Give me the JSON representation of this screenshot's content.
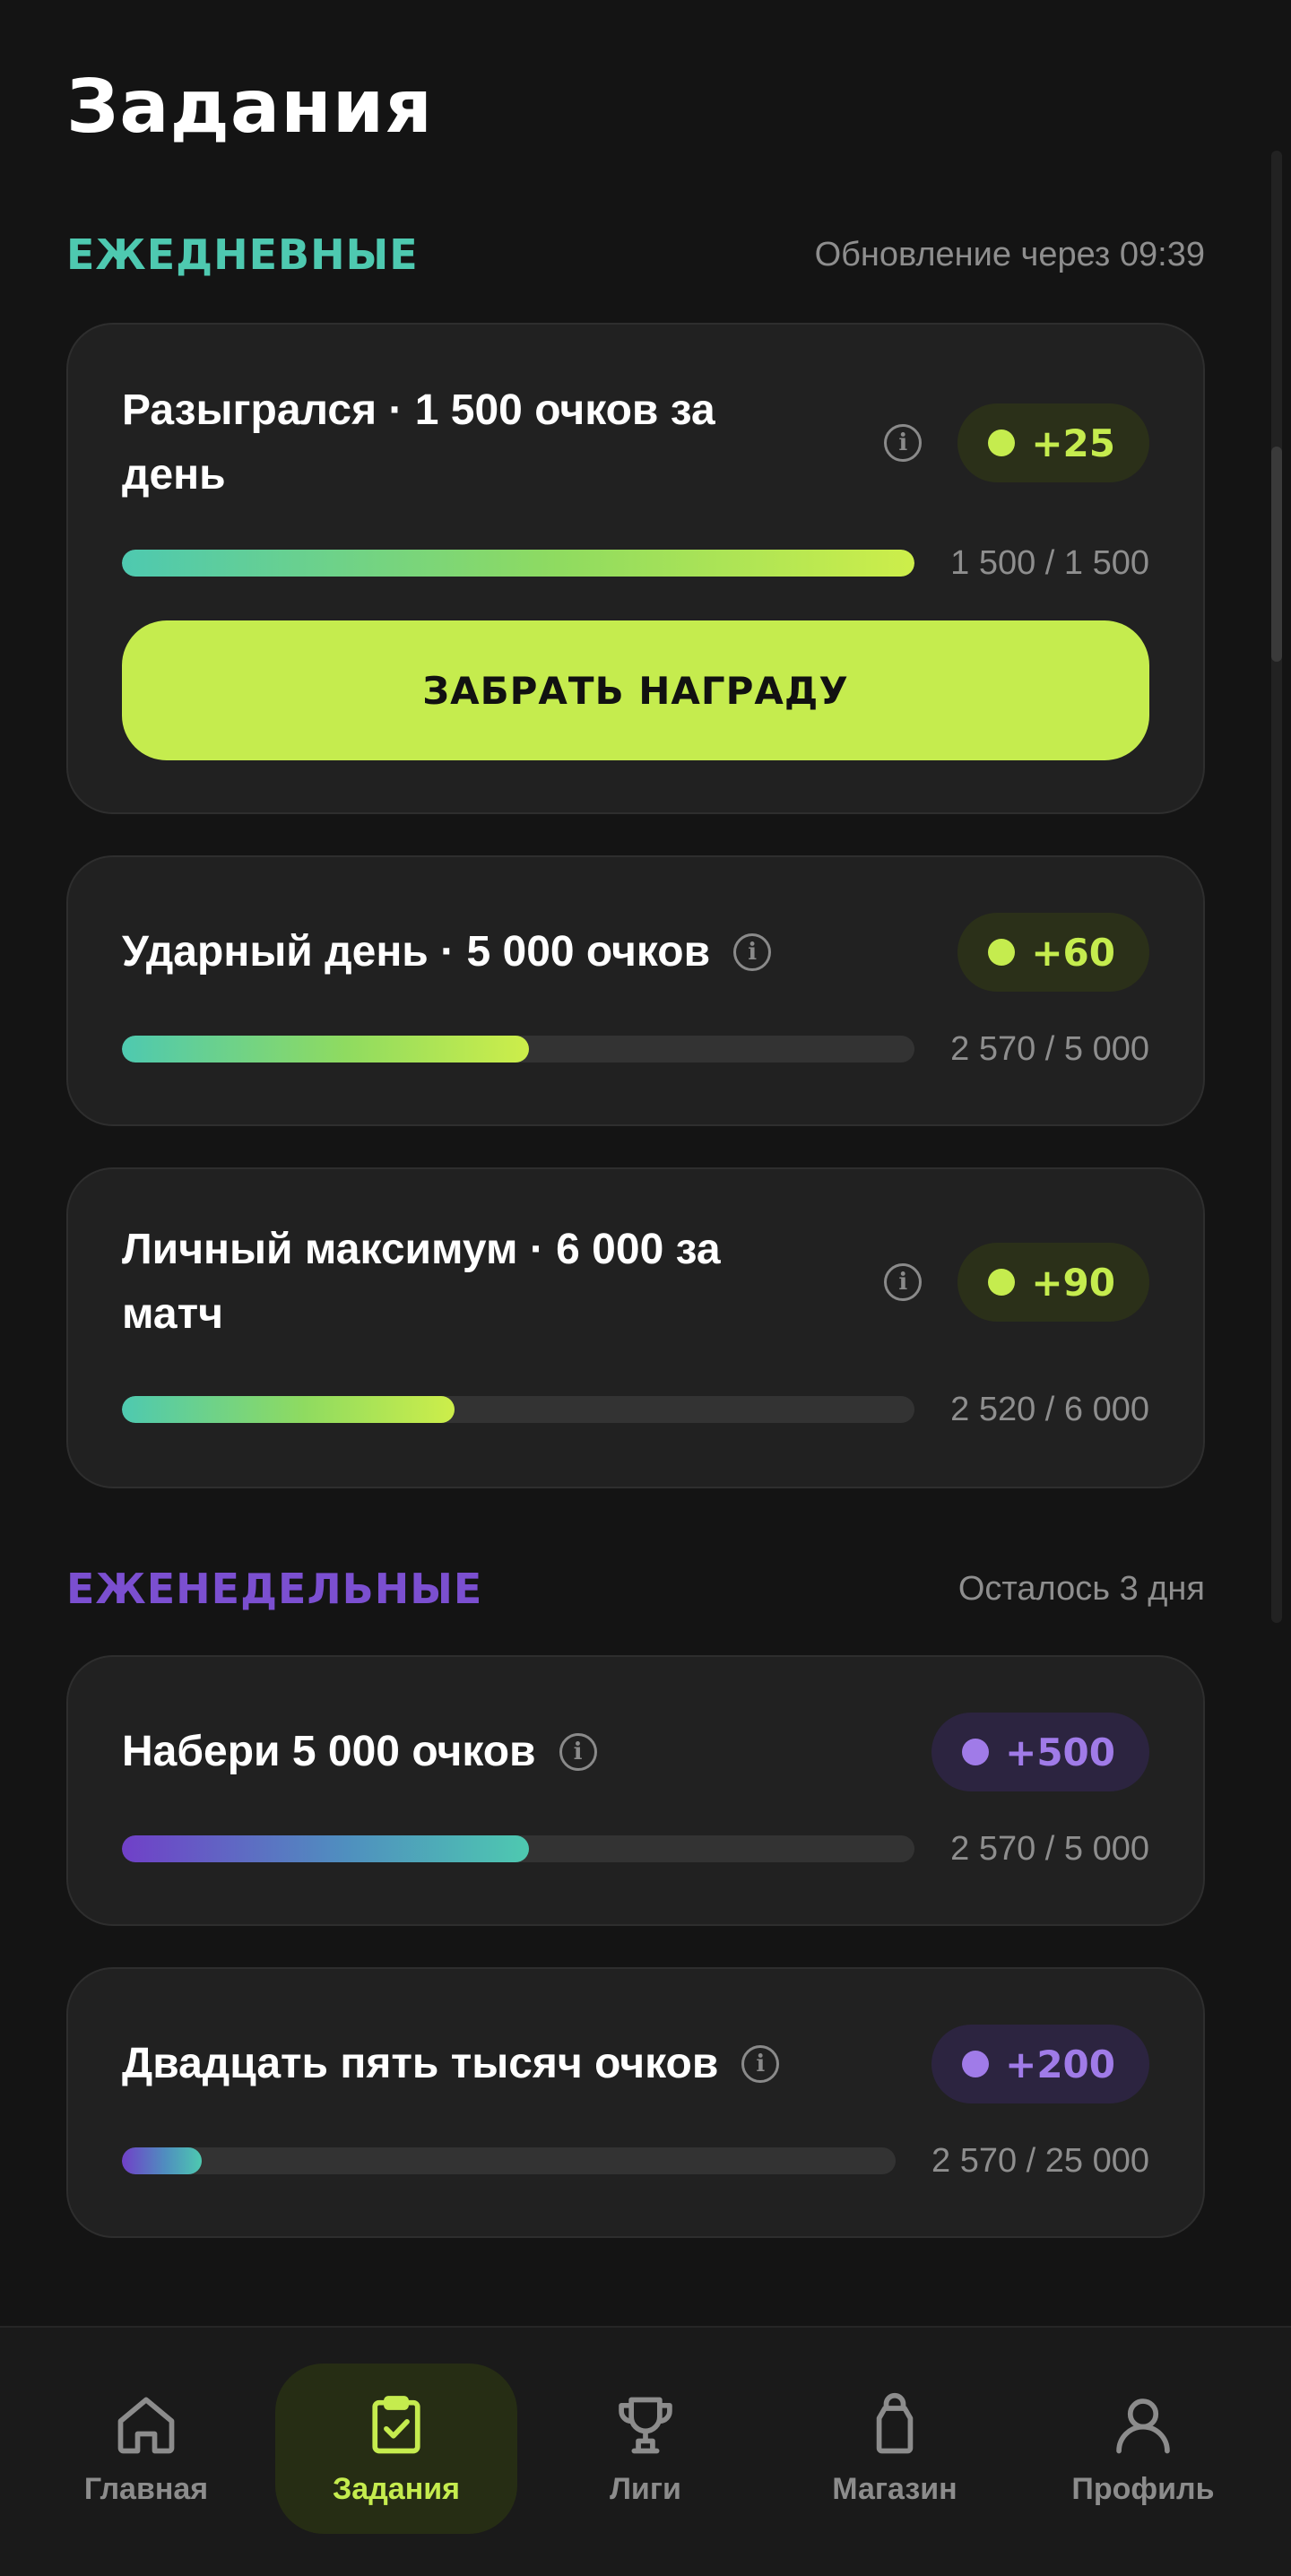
{
  "page": {
    "title": "Задания"
  },
  "daily": {
    "title": "ЕЖЕДНЕВНЫЕ",
    "meta": "Обновление через 09:39",
    "tasks": [
      {
        "line1": "Разыгрался · 1 500 очков за",
        "line2": "день",
        "reward": "+25",
        "progress": "1 500 / 1 500",
        "progress_fraction": 1.0,
        "button": "ЗАБРАТЬ НАГРАДУ"
      },
      {
        "line1": "Ударный день · 5 000 очков",
        "reward": "+60",
        "progress": "2 570 / 5 000",
        "progress_fraction": 0.514
      },
      {
        "line1": "Личный максимум · 6 000 за",
        "line2": "матч",
        "reward": "+90",
        "progress": "2 520 / 6 000",
        "progress_fraction": 0.42
      }
    ]
  },
  "weekly": {
    "title": "ЕЖЕНЕДЕЛЬНЫЕ",
    "meta": "Осталось 3 дня",
    "tasks": [
      {
        "line1": "Набери 5 000 очков",
        "reward": "+500",
        "progress": "2 570 / 5 000",
        "progress_fraction": 0.514
      },
      {
        "line1": "Двадцать пять тысяч очков",
        "reward": "+200",
        "progress": "2 570 / 25 000",
        "progress_fraction": 0.1028
      }
    ]
  },
  "nav": {
    "items": [
      {
        "label": "Главная",
        "icon": "home-icon"
      },
      {
        "label": "Задания",
        "icon": "clipboard-check-icon",
        "active": true
      },
      {
        "label": "Лиги",
        "icon": "trophy-icon"
      },
      {
        "label": "Магазин",
        "icon": "shopping-bag-icon"
      },
      {
        "label": "Профиль",
        "icon": "user-icon"
      }
    ]
  },
  "colors": {
    "accent_lime": "#c5ec4e",
    "accent_teal": "#4ec9b0",
    "accent_violet": "#7b4fd0",
    "background": "#141414",
    "card": "#212121"
  }
}
